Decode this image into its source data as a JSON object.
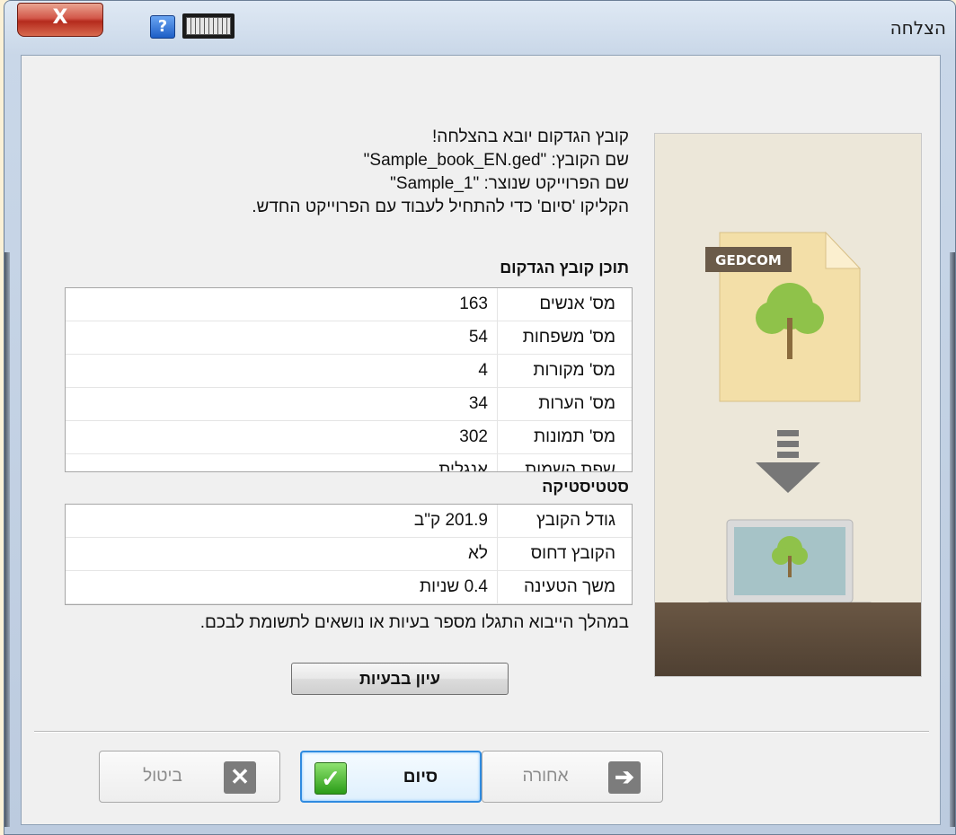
{
  "window": {
    "title": "הצלחה",
    "close_label": "X",
    "help_label": "?"
  },
  "message": {
    "line1": "קובץ הגדקום יובא בהצלחה!",
    "line2": "שם הקובץ: \"Sample_book_EN.ged\"",
    "line3": "שם הפרוייקט שנוצר: \"Sample_1\"",
    "line4": "הקליקו 'סיום' כדי להתחיל לעבוד עם הפרוייקט החדש."
  },
  "content_section": {
    "title": "תוכן קובץ הגדקום",
    "rows": [
      {
        "label": "מס' אנשים",
        "value": "163"
      },
      {
        "label": "מס' משפחות",
        "value": "54"
      },
      {
        "label": "מס' מקורות",
        "value": "4"
      },
      {
        "label": "מס' הערות",
        "value": "34"
      },
      {
        "label": "מס' תמונות",
        "value": "302"
      },
      {
        "label": "שפת השמות",
        "value": "אנגלית"
      }
    ]
  },
  "stats_section": {
    "title": "סטטיסטיקה",
    "rows": [
      {
        "label": "גודל הקובץ",
        "value": "201.9 ק\"ב"
      },
      {
        "label": "הקובץ דחוס",
        "value": "לא"
      },
      {
        "label": "משך הטעינה",
        "value": "0.4 שניות"
      }
    ]
  },
  "issues": {
    "note": "במהלך הייבוא התגלו מספר בעיות או נושאים לתשומת לבכם.",
    "button_label": "עיון בבעיות"
  },
  "illustration": {
    "file_badge": "GEDCOM"
  },
  "buttons": {
    "cancel": "ביטול",
    "finish": "סיום",
    "back": "אחורה"
  }
}
